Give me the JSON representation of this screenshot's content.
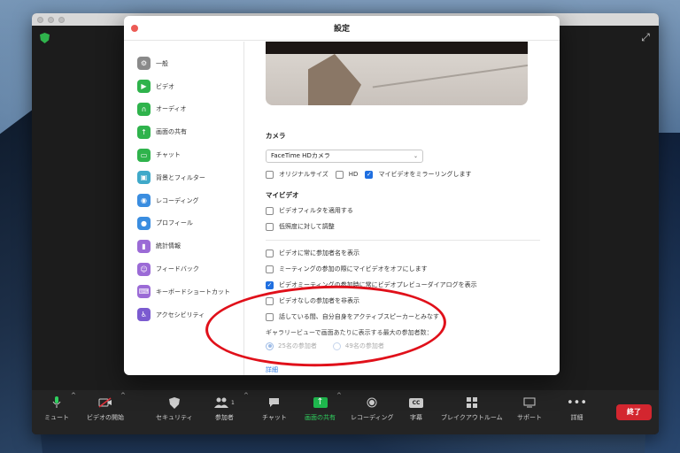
{
  "dialog": {
    "title": "設定"
  },
  "sidebar": {
    "items": [
      {
        "label": "一般",
        "icon": "gear-icon",
        "color": "#8a8a8a"
      },
      {
        "label": "ビデオ",
        "icon": "video-icon",
        "color": "#2fb34c"
      },
      {
        "label": "オーディオ",
        "icon": "headphones-icon",
        "color": "#2fb34c"
      },
      {
        "label": "画面の共有",
        "icon": "share-screen-icon",
        "color": "#2fb34c"
      },
      {
        "label": "チャット",
        "icon": "chat-icon",
        "color": "#2fb34c"
      },
      {
        "label": "背景とフィルター",
        "icon": "background-icon",
        "color": "#3fa9c9"
      },
      {
        "label": "レコーディング",
        "icon": "record-icon",
        "color": "#3a8de0"
      },
      {
        "label": "プロフィール",
        "icon": "profile-icon",
        "color": "#3a8de0"
      },
      {
        "label": "統計情報",
        "icon": "stats-icon",
        "color": "#9b6bd6"
      },
      {
        "label": "フィードバック",
        "icon": "feedback-icon",
        "color": "#9b6bd6"
      },
      {
        "label": "キーボードショートカット",
        "icon": "keyboard-icon",
        "color": "#9b6bd6"
      },
      {
        "label": "アクセシビリティ",
        "icon": "accessibility-icon",
        "color": "#7b5bd0"
      }
    ]
  },
  "camera": {
    "section_title": "カメラ",
    "selected": "FaceTime HDカメラ",
    "options": [
      {
        "label": "オリジナルサイズ",
        "checked": false
      },
      {
        "label": "HD",
        "checked": false
      },
      {
        "label": "マイビデオをミラーリングします",
        "checked": true
      }
    ]
  },
  "my_video": {
    "section_title": "マイビデオ",
    "options": [
      {
        "label": "ビデオフィルタを適用する",
        "checked": false
      },
      {
        "label": "低照度に対して調整",
        "checked": false
      }
    ]
  },
  "general_options": [
    {
      "label": "ビデオに常に参加者名を表示",
      "checked": false
    },
    {
      "label": "ミーティングの参加の際にマイビデオをオフにします",
      "checked": false
    },
    {
      "label": "ビデオミーティングの参加時に常にビデオプレビューダイアログを表示",
      "checked": true
    },
    {
      "label": "ビデオなしの参加者を非表示",
      "checked": false
    },
    {
      "label": "話している間、自分自身をアクティブスピーカーとみなす",
      "checked": false
    }
  ],
  "gallery": {
    "label": "ギャラリービューで画面あたりに表示する最大の参加者数：",
    "options": [
      {
        "label": "25名の参加者",
        "selected": true
      },
      {
        "label": "49名の参加者",
        "selected": false
      }
    ]
  },
  "detail_link": "詳細",
  "toolbar": {
    "mute": "ミュート",
    "start_video": "ビデオの開始",
    "security": "セキュリティ",
    "participants": "参加者",
    "participants_count": "1",
    "chat": "チャット",
    "share_screen": "画面の共有",
    "recording": "レコーディング",
    "captions": "字幕",
    "captions_icon_text": "CC",
    "breakout": "ブレイクアウトルーム",
    "support": "サポート",
    "more": "詳細",
    "end": "終了"
  },
  "colors": {
    "accent": "#1f6fe0",
    "share_green": "#1fba4f",
    "end_red": "#d3262f",
    "annotation_red": "#e0101a"
  }
}
